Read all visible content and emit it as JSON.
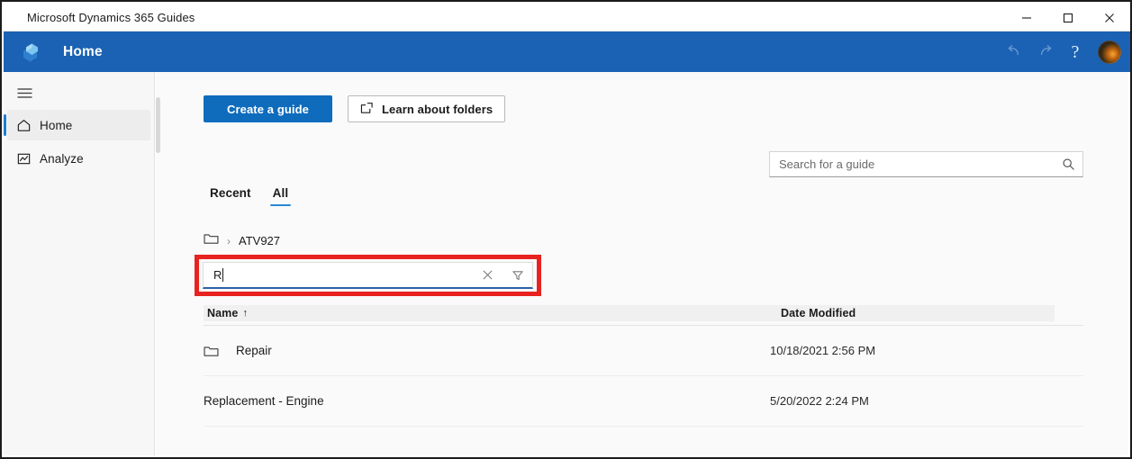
{
  "window": {
    "title": "Microsoft Dynamics 365 Guides",
    "controls": {
      "minimize": "minimize-icon",
      "maximize": "maximize-icon",
      "close": "close-icon"
    }
  },
  "appbar": {
    "logo_icon": "dynamics-guides-logo-icon",
    "title": "Home",
    "undo_icon": "undo-icon",
    "redo_icon": "redo-icon",
    "help_label": "?",
    "avatar_name": "user-avatar",
    "background_color": "#1b62b4"
  },
  "sidebar": {
    "menu_icon": "hamburger-menu-icon",
    "items": [
      {
        "label": "Home",
        "icon": "home-icon",
        "selected": true
      },
      {
        "label": "Analyze",
        "icon": "analytics-chart-icon",
        "selected": false
      }
    ],
    "selected_indicator_color": "#1b7fd1"
  },
  "toolbar": {
    "create_guide_label": "Create a guide",
    "create_guide_color": "#0f6cbd",
    "learn_folders_label": "Learn about folders",
    "learn_folders_icon": "open-in-new-icon"
  },
  "search": {
    "placeholder": "Search for a guide",
    "value": "",
    "icon": "search-icon"
  },
  "tabs": [
    {
      "label": "Recent",
      "active": false
    },
    {
      "label": "All",
      "active": true
    }
  ],
  "tab_underline_color": "#2b88d8",
  "breadcrumb": {
    "root_icon": "folder-icon",
    "separator": "›",
    "items": [
      "ATV927"
    ]
  },
  "filter": {
    "value": "R",
    "clear_icon": "clear-x-icon",
    "filter_icon": "filter-funnel-icon",
    "underline_color": "#2f5fa8",
    "highlight_color": "#e8231f"
  },
  "table": {
    "columns": [
      {
        "label": "Name",
        "sort": "↑"
      },
      {
        "label": "Date Modified",
        "sort": ""
      }
    ],
    "rows": [
      {
        "icon": "folder-icon",
        "name": "Repair",
        "date": "10/18/2021 2:56 PM"
      },
      {
        "icon": "",
        "name": "Replacement - Engine",
        "date": "5/20/2022 2:24 PM"
      }
    ]
  }
}
